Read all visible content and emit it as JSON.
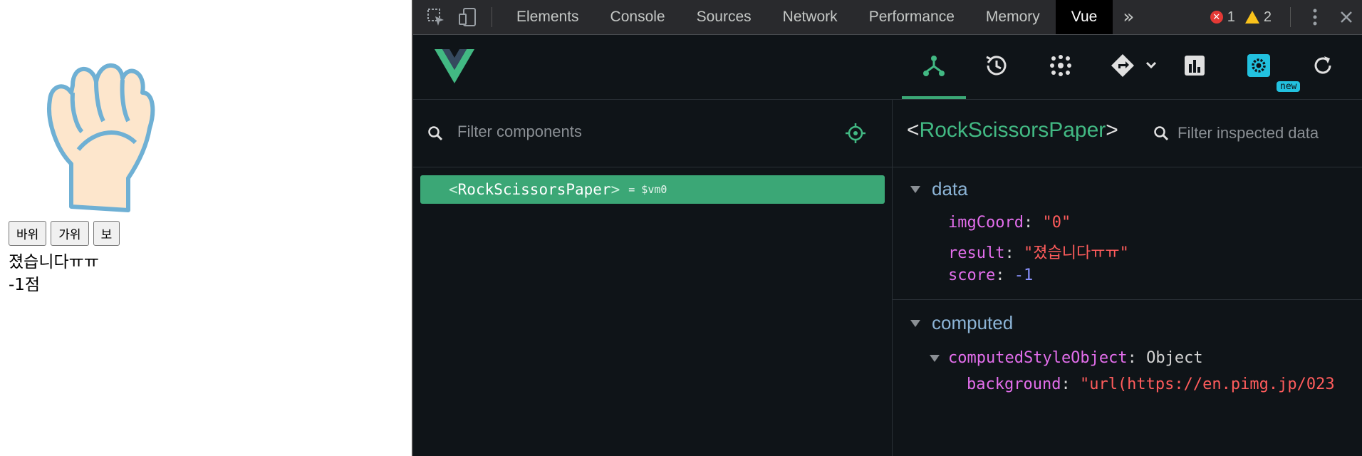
{
  "app": {
    "buttons": [
      "바위",
      "가위",
      "보"
    ],
    "result": "졌습니다ㅠㅠ",
    "score": "-1점"
  },
  "devtools": {
    "tabs": [
      "Elements",
      "Console",
      "Sources",
      "Network",
      "Performance",
      "Memory",
      "Vue"
    ],
    "active_tab": "Vue",
    "error_count": "1",
    "warning_count": "2",
    "new_badge": "new"
  },
  "vue": {
    "filter_components_placeholder": "Filter components",
    "filter_inspected_placeholder": "Filter inspected data",
    "component": {
      "name": "RockScissorsPaper",
      "open": "<",
      "close": ">",
      "vm": "= $vm0"
    },
    "sections": {
      "data": "data",
      "computed": "computed"
    },
    "data": {
      "imgCoord_key": "imgCoord",
      "imgCoord_val": "\"0\"",
      "result_key": "result",
      "result_val": "\"졌습니다ㅠㅠ\"",
      "score_key": "score",
      "score_val": "-1"
    },
    "computed": {
      "obj_key": "computedStyleObject",
      "obj_val": "Object",
      "bg_key": "background",
      "bg_val": "\"url(https://en.pimg.jp/023"
    }
  },
  "colors": {
    "accent_green": "#3ba776",
    "vue_green": "#42b983",
    "string_red": "#ff5c5c",
    "key_magenta": "#e36eec",
    "number_blue": "#8b93ff"
  }
}
